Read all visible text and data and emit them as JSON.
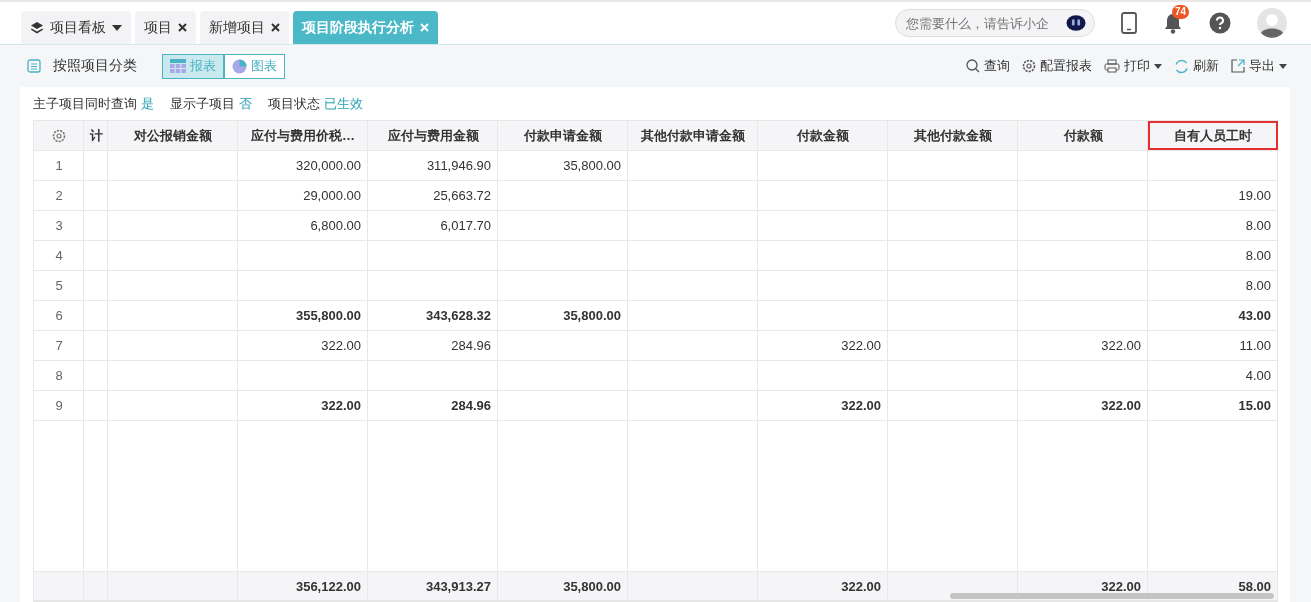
{
  "tabs": [
    {
      "label": "项目看板",
      "kind": "menu",
      "selected": false
    },
    {
      "label": "项目",
      "kind": "closable",
      "selected": false
    },
    {
      "label": "新增项目",
      "kind": "closable",
      "selected": false
    },
    {
      "label": "项目阶段执行分析",
      "kind": "closable",
      "selected": true
    }
  ],
  "assistant_search": {
    "placeholder": "您需要什么，请告诉小企"
  },
  "notifications": {
    "count": "74"
  },
  "toolbar": {
    "title": "按照项目分类",
    "views": [
      {
        "label": "报表",
        "kind": "table",
        "selected": true
      },
      {
        "label": "图表",
        "kind": "chart",
        "selected": false
      }
    ],
    "actions": [
      {
        "label": "查询",
        "kind": "search",
        "dropdown": false
      },
      {
        "label": "配置报表",
        "kind": "settings",
        "dropdown": false
      },
      {
        "label": "打印",
        "kind": "print",
        "dropdown": true
      },
      {
        "label": "刷新",
        "kind": "refresh",
        "dropdown": false
      },
      {
        "label": "导出",
        "kind": "export",
        "dropdown": true
      }
    ]
  },
  "filters": [
    {
      "label": "主子项目同时查询",
      "value": "是"
    },
    {
      "label": "显示子项目",
      "value": "否"
    },
    {
      "label": "项目状态",
      "value": "已生效"
    }
  ],
  "table": {
    "columns": [
      {
        "label": "计",
        "highlighted": false
      },
      {
        "label": "对公报销金额",
        "highlighted": false
      },
      {
        "label": "应付与费用价税…",
        "highlighted": false
      },
      {
        "label": "应付与费用金额",
        "highlighted": false
      },
      {
        "label": "付款申请金额",
        "highlighted": false
      },
      {
        "label": "其他付款申请金额",
        "highlighted": false
      },
      {
        "label": "付款金额",
        "highlighted": false
      },
      {
        "label": "其他付款金额",
        "highlighted": false
      },
      {
        "label": "付款额",
        "highlighted": false
      },
      {
        "label": "自有人员工时",
        "highlighted": true
      }
    ],
    "rows": [
      {
        "index": "1",
        "bold": false,
        "cells": {
          "column_3": "320,000.00",
          "column_4": "311,946.90",
          "column_5": "35,800.00"
        }
      },
      {
        "index": "2",
        "bold": false,
        "cells": {
          "column_3": "29,000.00",
          "column_4": "25,663.72",
          "column_10": "19.00"
        }
      },
      {
        "index": "3",
        "bold": false,
        "cells": {
          "column_3": "6,800.00",
          "column_4": "6,017.70",
          "column_10": "8.00"
        }
      },
      {
        "index": "4",
        "bold": false,
        "cells": {
          "column_10": "8.00"
        }
      },
      {
        "index": "5",
        "bold": false,
        "cells": {
          "column_10": "8.00"
        }
      },
      {
        "index": "6",
        "bold": true,
        "cells": {
          "column_3": "355,800.00",
          "column_4": "343,628.32",
          "column_5": "35,800.00",
          "column_10": "43.00"
        }
      },
      {
        "index": "7",
        "bold": false,
        "cells": {
          "column_3": "322.00",
          "column_4": "284.96",
          "column_7": "322.00",
          "column_9": "322.00",
          "column_10": "11.00"
        }
      },
      {
        "index": "8",
        "bold": false,
        "cells": {
          "column_10": "4.00"
        }
      },
      {
        "index": "9",
        "bold": true,
        "cells": {
          "column_3": "322.00",
          "column_4": "284.96",
          "column_7": "322.00",
          "column_9": "322.00",
          "column_10": "15.00"
        }
      }
    ],
    "totals": {
      "column_3": "356,122.00",
      "column_4": "343,913.27",
      "column_5": "35,800.00",
      "column_7": "322.00",
      "column_9": "322.00",
      "column_10": "58.00"
    }
  }
}
